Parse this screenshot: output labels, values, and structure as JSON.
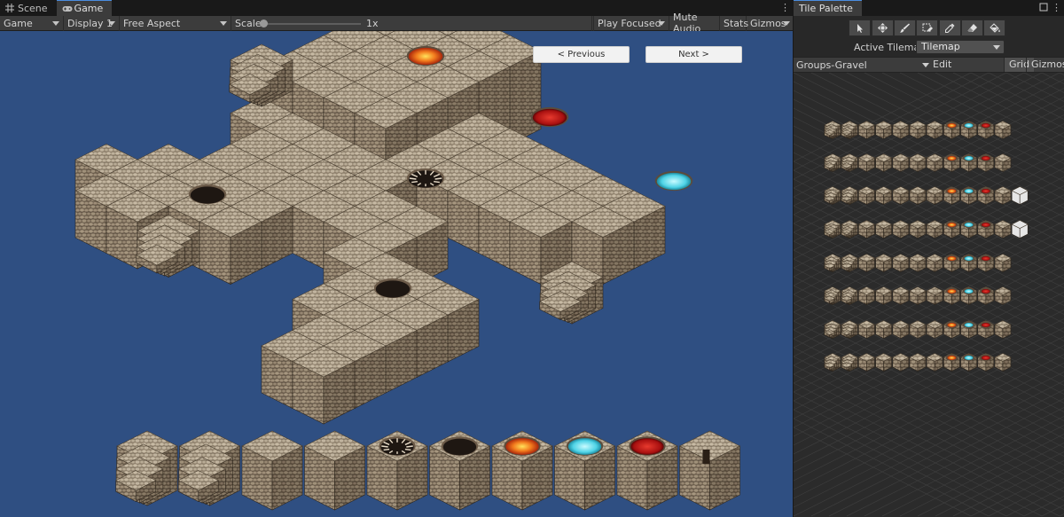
{
  "game": {
    "tabs": [
      {
        "label": "Scene",
        "icon": "grid-icon"
      },
      {
        "label": "Game",
        "icon": "gamepad-icon"
      }
    ],
    "toolbar": {
      "display_mode": "Game",
      "display": "Display 1",
      "aspect": "Free Aspect",
      "scale_label": "Scale",
      "scale_value": "1x",
      "play_focused": "Play Focused",
      "mute_audio": "Mute Audio",
      "stats": "Stats",
      "gizmos": "Gizmos"
    },
    "buttons": {
      "previous": "< Previous",
      "next": "Next >"
    },
    "colors": {
      "viewport_bg": "#2f4f82",
      "stone_top": "#bfb29d",
      "stone_left": "#938470",
      "stone_right": "#756856",
      "lava": "#e8601a",
      "water": "#4fd3e6",
      "blood": "#b81818"
    },
    "tile_strip": [
      "stairs",
      "stairs",
      "block",
      "block",
      "spike-pit",
      "pit",
      "lava",
      "water",
      "blood",
      "doorway"
    ]
  },
  "palette": {
    "title": "Tile Palette",
    "tools": [
      "select-icon",
      "move-icon",
      "brush-icon",
      "box-fill-icon",
      "picker-icon",
      "eraser-icon",
      "fill-icon"
    ],
    "active_tilemap_label": "Active Tilemap",
    "active_tilemap_value": "Tilemap",
    "group": "Groups-Gravel",
    "edit": "Edit",
    "grid": "Grid",
    "gizmos": "Gizmos",
    "rows": [
      [
        "stairs",
        "stairs",
        "block",
        "block",
        "block",
        "block",
        "block",
        "lava",
        "water",
        "blood",
        "block"
      ],
      [
        "stairs",
        "stairs",
        "block",
        "block",
        "block",
        "block",
        "block",
        "lava",
        "water",
        "blood",
        "block"
      ],
      [
        "stairs",
        "stairs",
        "block",
        "block",
        "block",
        "block",
        "block",
        "lava",
        "water",
        "blood",
        "block",
        "white"
      ],
      [
        "stairs",
        "stairs",
        "block",
        "block",
        "block",
        "block",
        "block",
        "lava",
        "water",
        "blood",
        "block",
        "white"
      ],
      [
        "stairs",
        "stairs",
        "block",
        "block",
        "block",
        "block",
        "block",
        "lava",
        "water",
        "blood",
        "block"
      ],
      [
        "stairs",
        "stairs",
        "block",
        "block",
        "block",
        "block",
        "block",
        "lava",
        "water",
        "blood",
        "block"
      ],
      [
        "stairs",
        "stairs",
        "block",
        "block",
        "block",
        "block",
        "block",
        "lava",
        "water",
        "blood",
        "block"
      ],
      [
        "stairs",
        "stairs",
        "block",
        "block",
        "block",
        "block",
        "block",
        "lava",
        "water",
        "blood",
        "block"
      ]
    ]
  }
}
